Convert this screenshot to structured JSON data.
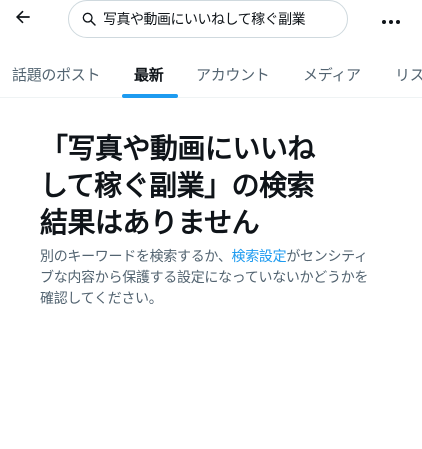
{
  "header": {
    "search": {
      "value": "写真や動画にいいねして稼ぐ副業",
      "placeholder": ""
    },
    "icons": {
      "back": "back-arrow-icon",
      "search": "search-icon",
      "more": "more-icon"
    }
  },
  "tabs": [
    {
      "label": "話題のポスト",
      "active": false
    },
    {
      "label": "最新",
      "active": true
    },
    {
      "label": "アカウント",
      "active": false
    },
    {
      "label": "メディア",
      "active": false
    },
    {
      "label": "リス",
      "active": false
    }
  ],
  "empty_state": {
    "title_line1": "「写真や動画にいいね",
    "title_line2": "して稼ぐ副業」の検索",
    "title_line3": "結果はありません",
    "desc_before": "別のキーワードを検索するか、",
    "desc_link": "検索設定",
    "desc_after": "がセンシティブな内容から保護する設定になっていないかどうかを確認してください。"
  },
  "colors": {
    "accent": "#1d9bf0",
    "text_primary": "#0f1419",
    "text_secondary": "#536471",
    "border": "#cfd9de"
  }
}
